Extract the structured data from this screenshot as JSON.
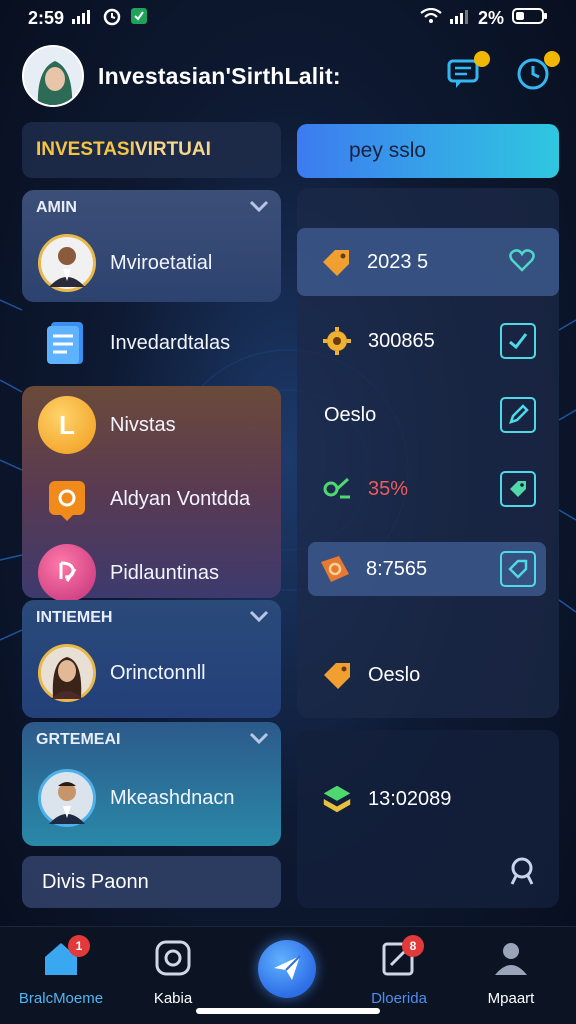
{
  "status_bar": {
    "time": "2:59",
    "battery": "2%"
  },
  "header": {
    "title": "Investasian'SirthLalit:"
  },
  "left": {
    "title_card": {
      "part1": "INVESTASI ",
      "part2": "VIRTUAI"
    },
    "group1": {
      "heading": "AMIN",
      "items": [
        {
          "label": "Mviroetatial"
        }
      ]
    },
    "solo_item": {
      "label": "Invedardtalas"
    },
    "group2": {
      "items": [
        {
          "label": "Nivstas"
        },
        {
          "label": "Aldyan Vontdda"
        },
        {
          "label": "Pidlauntinas"
        }
      ]
    },
    "group3": {
      "heading": "INTIEMEH",
      "items": [
        {
          "label": "Orinctonnll"
        }
      ]
    },
    "group4": {
      "heading": "GRTEMEAI",
      "items": [
        {
          "label": "Mkeashdnacn"
        }
      ]
    },
    "bottom_card": {
      "label": "Divis Paonn"
    }
  },
  "right": {
    "top_button": {
      "label": "pey sslo"
    },
    "rows": [
      {
        "value": "2023 5"
      },
      {
        "value": "300865"
      },
      {
        "value": "Oeslo"
      },
      {
        "value": "35%"
      },
      {
        "value": "8:7565"
      },
      {
        "value": "Oeslo"
      }
    ],
    "bottom_row": {
      "value": "13:02089"
    }
  },
  "nav": {
    "items": [
      {
        "label": "BralcMoeme",
        "badge": "1"
      },
      {
        "label": "Kabia"
      },
      {
        "label": "Dloerida",
        "badge": "8"
      },
      {
        "label": "Mpaart"
      }
    ]
  },
  "colors": {
    "accent": "#2fc7e0",
    "badge_red": "#e23a3a",
    "badge_yellow": "#f2b705",
    "percent_red": "#f05a5a"
  }
}
